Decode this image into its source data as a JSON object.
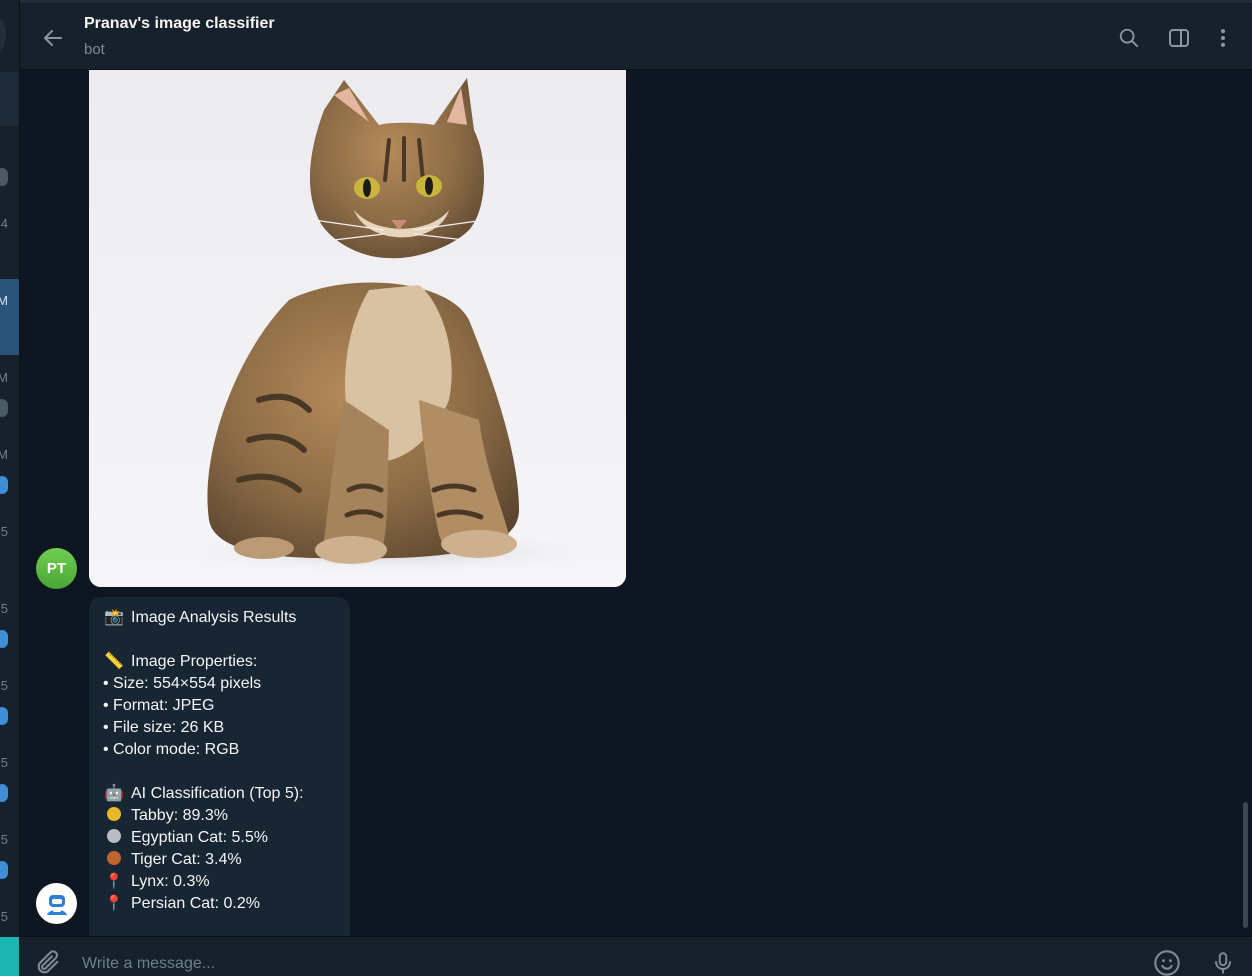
{
  "header": {
    "title": "Pranav's image classifier",
    "subtitle": "bot"
  },
  "sidebar": {
    "times": [
      "4",
      "M",
      "M",
      "M",
      "5",
      "5",
      "5",
      "5",
      "5",
      "5"
    ]
  },
  "chat": {
    "sender_initials": "PT",
    "result_title": "Image Analysis Results",
    "properties_heading": "Image Properties:",
    "properties": [
      "• Size: 554×554 pixels",
      "• Format: JPEG",
      "• File size: 26 KB",
      "• Color mode: RGB"
    ],
    "classification_heading": "AI Classification (Top 5):",
    "classifications": [
      "Tabby: 89.3%",
      "Egyptian Cat: 5.5%",
      "Tiger Cat: 3.4%",
      "Lynx: 0.3%",
      "Persian Cat: 0.2%"
    ]
  },
  "composer": {
    "placeholder": "Write a message..."
  },
  "colors": {
    "background": "#0e1621",
    "panel": "#17212b",
    "bubble": "#182533",
    "active_chat": "#2b5278",
    "accent": "#3e8ed8"
  }
}
